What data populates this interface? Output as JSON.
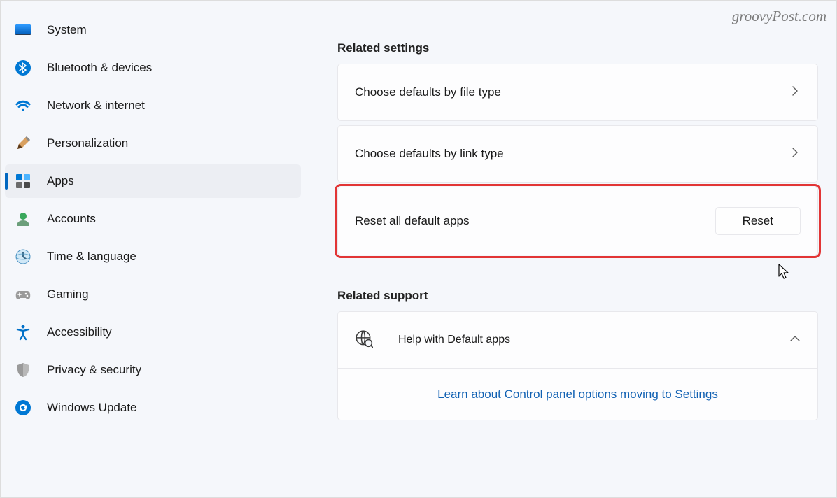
{
  "watermark": "groovyPost.com",
  "sidebar": {
    "items": [
      {
        "icon": "system-icon",
        "label": "System"
      },
      {
        "icon": "bluetooth-icon",
        "label": "Bluetooth & devices"
      },
      {
        "icon": "network-icon",
        "label": "Network & internet"
      },
      {
        "icon": "personalization-icon",
        "label": "Personalization"
      },
      {
        "icon": "apps-icon",
        "label": "Apps",
        "active": true
      },
      {
        "icon": "accounts-icon",
        "label": "Accounts"
      },
      {
        "icon": "time-language-icon",
        "label": "Time & language"
      },
      {
        "icon": "gaming-icon",
        "label": "Gaming"
      },
      {
        "icon": "accessibility-icon",
        "label": "Accessibility"
      },
      {
        "icon": "privacy-security-icon",
        "label": "Privacy & security"
      },
      {
        "icon": "windows-update-icon",
        "label": "Windows Update"
      }
    ]
  },
  "main": {
    "related_settings_header": "Related settings",
    "file_type_card": "Choose defaults by file type",
    "link_type_card": "Choose defaults by link type",
    "reset_card": {
      "title": "Reset all default apps",
      "button": "Reset"
    },
    "related_support_header": "Related support",
    "help_card": "Help with Default apps",
    "learn_link": "Learn about Control panel options moving to Settings"
  }
}
